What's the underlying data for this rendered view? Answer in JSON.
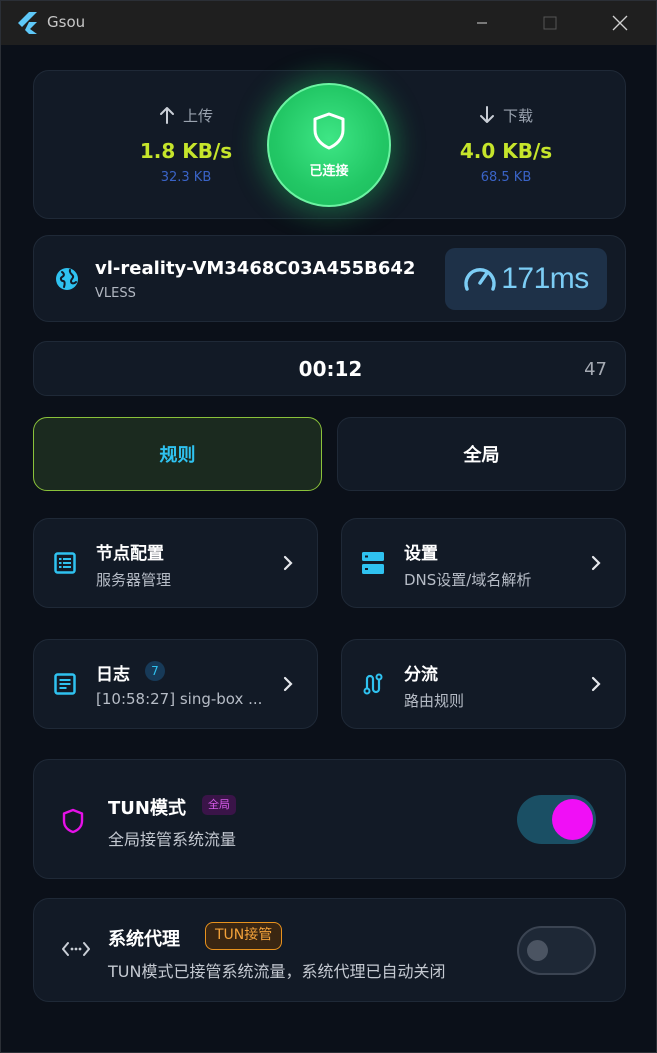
{
  "window": {
    "title": "Gsou"
  },
  "stats": {
    "upload": {
      "label": "上传",
      "speed": "1.8 KB/s",
      "total": "32.3 KB"
    },
    "download": {
      "label": "下载",
      "speed": "4.0 KB/s",
      "total": "68.5 KB"
    },
    "connection": {
      "label": "已连接",
      "status": "connected"
    }
  },
  "node": {
    "name": "vl-reality-VM3468C03A455B642",
    "protocol": "VLESS",
    "latency": "171ms"
  },
  "timer": {
    "elapsed": "00:12",
    "count": "47"
  },
  "modes": {
    "rule": "规则",
    "global": "全局",
    "active": "rule"
  },
  "menu": {
    "nodes": {
      "title": "节点配置",
      "subtitle": "服务器管理"
    },
    "settings": {
      "title": "设置",
      "subtitle": "DNS设置/域名解析"
    },
    "logs": {
      "title": "日志",
      "badge": "7",
      "subtitle": "[10:58:27] sing-box ..."
    },
    "routing": {
      "title": "分流",
      "subtitle": "路由规则"
    }
  },
  "tun": {
    "title": "TUN模式",
    "tag": "全局",
    "subtitle": "全局接管系统流量",
    "enabled": true
  },
  "system_proxy": {
    "title": "系统代理",
    "tag": "TUN接管",
    "subtitle": "TUN模式已接管系统流量，系统代理已自动关闭",
    "enabled": false
  },
  "colors": {
    "accent_cyan": "#2fc2f0",
    "speed_green": "#c6e52b",
    "connect_green": "#22c765",
    "tun_magenta": "#f00ff6",
    "tag_orange": "#e8921e",
    "card_bg": "#121a26",
    "window_bg": "#0b1019"
  },
  "icons": {
    "app": "flutter-logo-icon",
    "upload": "arrow-up-icon",
    "download": "arrow-down-icon",
    "connect": "shield-icon",
    "node": "globe-icon",
    "latency": "speedometer-icon",
    "nodes": "list-icon",
    "settings": "server-icon",
    "logs": "document-icon",
    "routing": "route-icon",
    "tun": "shield-outline-icon",
    "proxy": "proxy-arrows-icon"
  }
}
